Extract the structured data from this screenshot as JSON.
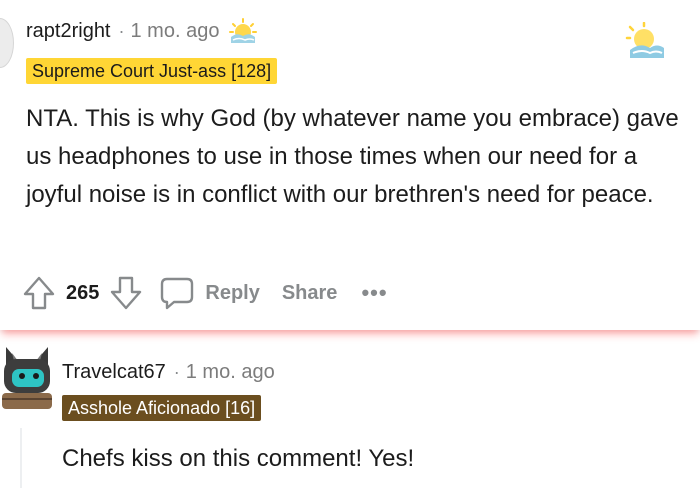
{
  "comment1": {
    "username": "rapt2right",
    "separator": "·",
    "time": "1 mo. ago",
    "flair": "Supreme Court Just-ass [128]",
    "body": "NTA. This is why God (by whatever name you embrace) gave us headphones to use in those times when our need for a joyful noise is in conflict with our brethren's need for peace.",
    "votes": "265",
    "reply_label": "Reply",
    "share_label": "Share",
    "more_label": "•••",
    "award_icons": [
      "sunrise-award-icon",
      "sunrise-award-icon"
    ],
    "colors": {
      "flair_bg": "#ffd635",
      "shadow": "#ff4646"
    }
  },
  "comment2": {
    "username": "Travelcat67",
    "separator": "·",
    "time": "1 mo. ago",
    "flair": "Asshole Aficionado [16]",
    "body": "Chefs kiss on this comment! Yes!",
    "colors": {
      "flair_bg": "#6b4e1f",
      "avatar_accent": "#2ec4c4"
    }
  }
}
